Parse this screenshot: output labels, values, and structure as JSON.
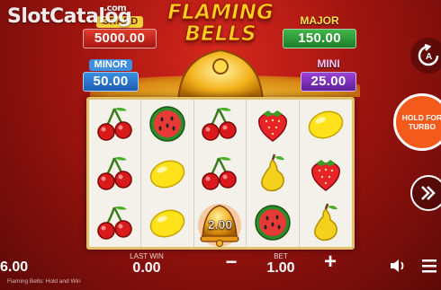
{
  "watermark": {
    "text": "SlotCatalog",
    "domain": ".com"
  },
  "game": {
    "logo_line1": "FLAMING",
    "logo_line2": "BELLS",
    "name": "Flaming Bells: Hold and Win"
  },
  "jackpots": {
    "grand": {
      "label": "GRAND",
      "value": "5000.00",
      "color": "#a8150f"
    },
    "major": {
      "label": "MAJOR",
      "value": "150.00",
      "color": "#1d7d28"
    },
    "minor": {
      "label": "MINOR",
      "value": "50.00",
      "color": "#1c5cb3"
    },
    "mini": {
      "label": "MINI",
      "value": "25.00",
      "color": "#5f1e9b"
    }
  },
  "reels": [
    [
      "cherry",
      "cherry",
      "cherry"
    ],
    [
      "watermelon",
      "lemon",
      "lemon"
    ],
    [
      "cherry",
      "cherry",
      "bell"
    ],
    [
      "strawberry",
      "pear",
      "watermelon"
    ],
    [
      "lemon",
      "strawberry",
      "pear"
    ]
  ],
  "bell_value": "2.00",
  "controls": {
    "autoplay_icon": "autoplay-icon",
    "hold_label_1": "HOLD FOR",
    "hold_label_2": "TURBO",
    "spin_icon": "spin-icon"
  },
  "bottom": {
    "balance": "6.00",
    "last_win_label": "LAST WIN",
    "last_win": "0.00",
    "minus": "−",
    "bet_label": "BET",
    "bet": "1.00",
    "plus": "+"
  }
}
